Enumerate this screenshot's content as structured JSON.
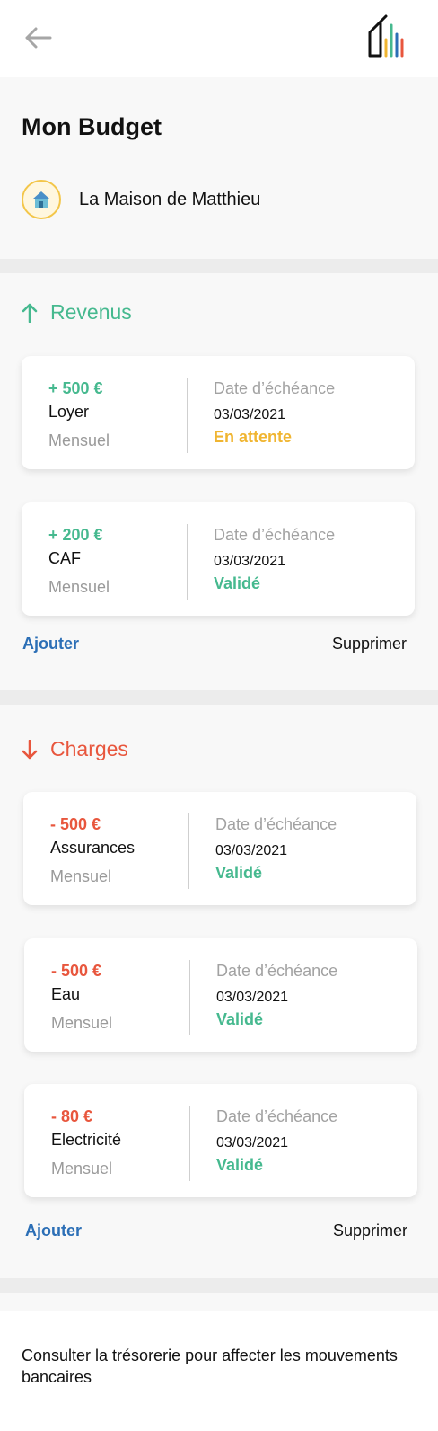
{
  "header": {
    "title": "Mon Budget",
    "home_name": "La Maison de Matthieu"
  },
  "revenus": {
    "title": "Revenus",
    "items": [
      {
        "amount": "+ 500 €",
        "label": "Loyer",
        "frequency": "Mensuel",
        "due_label": "Date d’échéance",
        "due_date": "03/03/2021",
        "status": "En attente"
      },
      {
        "amount": "+ 200 €",
        "label": "CAF",
        "frequency": "Mensuel",
        "due_label": "Date d’échéance",
        "due_date": "03/03/2021",
        "status": "Validé"
      }
    ],
    "add_label": "Ajouter",
    "delete_label": "Supprimer"
  },
  "charges": {
    "title": "Charges",
    "items": [
      {
        "amount": "- 500 €",
        "label": "Assurances",
        "frequency": "Mensuel",
        "due_label": "Date d’échéance",
        "due_date": "03/03/2021",
        "status": "Validé"
      },
      {
        "amount": "- 500 €",
        "label": "Eau",
        "frequency": "Mensuel",
        "due_label": "Date d’échéance",
        "due_date": "03/03/2021",
        "status": "Validé"
      },
      {
        "amount": "- 80 €",
        "label": "Electricité",
        "frequency": "Mensuel",
        "due_label": "Date d’échéance",
        "due_date": "03/03/2021",
        "status": "Validé"
      }
    ],
    "add_label": "Ajouter",
    "delete_label": "Supprimer"
  },
  "footer": {
    "text": "Consulter la trésorerie pour affecter les mouvements bancaires"
  },
  "colors": {
    "income": "#46b98f",
    "expense": "#e8563d",
    "pending": "#f0b531",
    "link": "#2c6fb6"
  },
  "icons": {
    "back": "arrow-left-icon",
    "logo": "house-bars-logo",
    "home": "house-icon",
    "income": "arrow-up-icon",
    "expense": "arrow-down-icon"
  }
}
